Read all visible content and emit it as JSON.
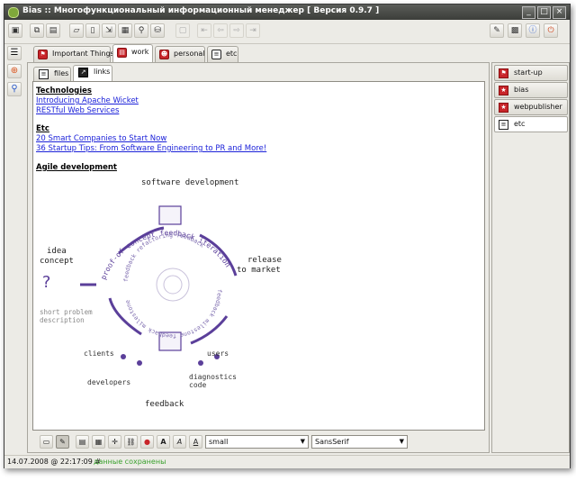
{
  "window": {
    "title": "Bias :: Многофункциональный информационный менеджер [ Версия 0.9.7 ]",
    "buttons": [
      "_",
      "□",
      "×"
    ]
  },
  "toolbar": {
    "left_icons": [
      "save-icon",
      "copy-icon",
      "note-icon",
      "open-folder-icon",
      "new-document-icon",
      "insert-icon",
      "import-icon",
      "find-replace-icon",
      "database-icon",
      "trash-icon",
      "first-icon",
      "back-icon",
      "forward-icon",
      "last-icon"
    ],
    "right_icons": [
      "tools-icon",
      "plugin-icon",
      "info-icon",
      "power-icon"
    ]
  },
  "left_icons": [
    "list-icon",
    "addon-icon",
    "search-icon"
  ],
  "top_tabs": [
    {
      "label": "Important Things",
      "icon": "red-flag-icon"
    },
    {
      "label": "work",
      "icon": "red-doc-icon"
    },
    {
      "label": "personal",
      "icon": "red-person-icon"
    },
    {
      "label": "etc",
      "icon": "doc-icon"
    }
  ],
  "sub_tabs": [
    {
      "label": "files",
      "icon": "doc-icon"
    },
    {
      "label": "links",
      "icon": "arrow-icon"
    }
  ],
  "content": {
    "sections": [
      {
        "heading": "Technologies",
        "links": [
          "Introducing Apache Wicket",
          "RESTful Web Services"
        ]
      },
      {
        "heading": "Etc",
        "links": [
          "20 Smart Companies to Start Now",
          "36 Startup Tips: From Software Engineering to PR and More!"
        ]
      },
      {
        "heading": "Agile development",
        "links": []
      }
    ],
    "diagram": {
      "software_development": "software development",
      "idea_1": "idea",
      "idea_2": "concept",
      "release_1": "release",
      "release_2": "to market",
      "short_problem_1": "short problem",
      "short_problem_2": "description",
      "clients": "clients",
      "users": "users",
      "developers": "developers",
      "diagnostics_1": "diagnostics",
      "diagnostics_2": "code",
      "feedback": "feedback",
      "arc_text": "proof-of-concept feedback iteration",
      "arc_inner": "feedback refactoring feedback",
      "arc_inner2": "feedback milestone feedback milestone"
    }
  },
  "bottom_toolbar": {
    "font_size": "small",
    "font_family": "SansSerif"
  },
  "right_tabs": [
    {
      "label": "start-up",
      "icon": "red-flag-icon"
    },
    {
      "label": "bias",
      "icon": "red-star-icon"
    },
    {
      "label": "webpublisher",
      "icon": "red-star-icon"
    },
    {
      "label": "etc",
      "icon": "doc-icon"
    }
  ],
  "status": {
    "timestamp": "14.07.2008 @ 22:17:09 #",
    "message": "данные сохранены"
  }
}
